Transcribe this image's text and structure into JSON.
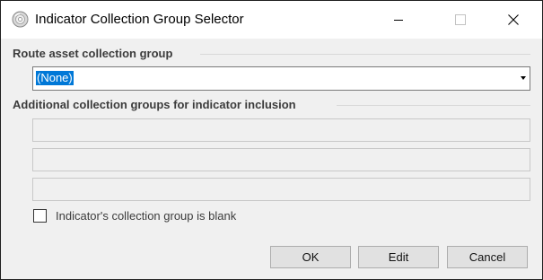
{
  "window": {
    "title": "Indicator Collection Group Selector",
    "app_icon": "disc-icon",
    "controls": [
      "minimize-icon",
      "maximize-icon",
      "close-icon"
    ]
  },
  "route_group": {
    "label": "Route asset collection group",
    "selected_value": "(None)",
    "dropdown_icon": "chevron-down-icon"
  },
  "additional_groups": {
    "label": "Additional collection groups for indicator inclusion",
    "fields": [
      "",
      "",
      ""
    ]
  },
  "blank_checkbox": {
    "label": "Indicator's collection group is blank",
    "checked": false
  },
  "buttons": {
    "ok": "OK",
    "edit": "Edit",
    "cancel": "Cancel"
  },
  "colors": {
    "selection": "#0078d7",
    "background": "#f0f0f0",
    "titlebar": "#ffffff"
  }
}
